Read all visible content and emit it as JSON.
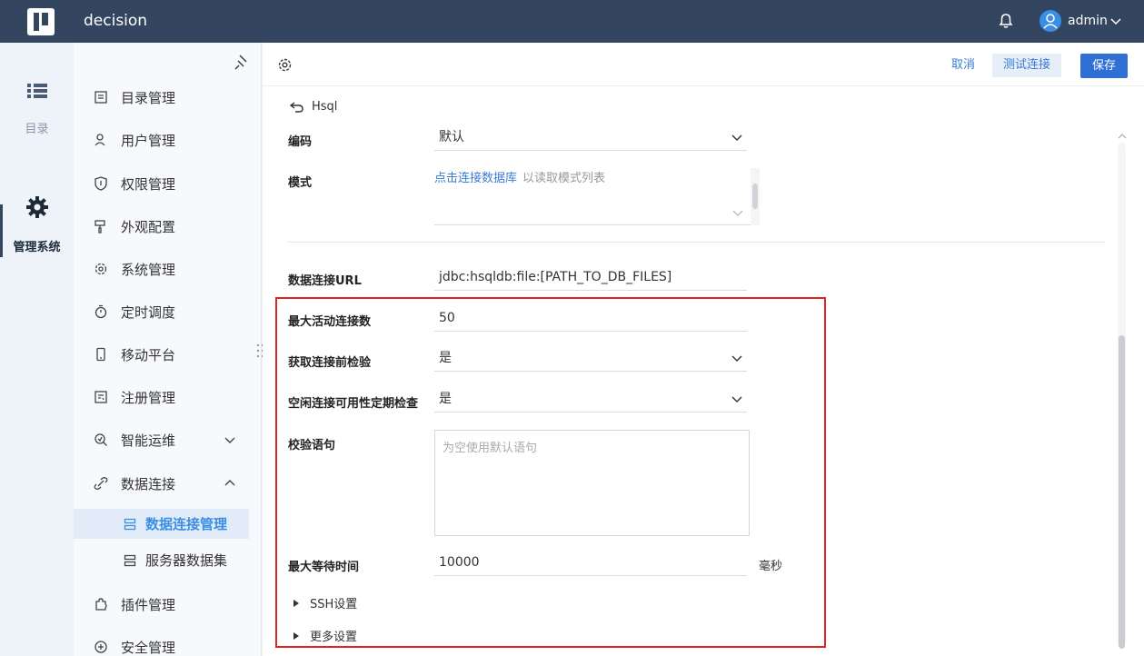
{
  "header": {
    "app_title": "decision",
    "username": "admin"
  },
  "rail": {
    "directory_label": "目录",
    "system_label": "管理系统"
  },
  "menu": {
    "items": [
      {
        "label": "目录管理",
        "icon": "list-icon"
      },
      {
        "label": "用户管理",
        "icon": "user-icon"
      },
      {
        "label": "权限管理",
        "icon": "shield-icon"
      },
      {
        "label": "外观配置",
        "icon": "paint-icon"
      },
      {
        "label": "系统管理",
        "icon": "gear-icon"
      },
      {
        "label": "定时调度",
        "icon": "timer-icon"
      },
      {
        "label": "移动平台",
        "icon": "mobile-icon"
      },
      {
        "label": "注册管理",
        "icon": "register-icon"
      },
      {
        "label": "智能运维",
        "icon": "ops-icon"
      },
      {
        "label": "数据连接",
        "icon": "link-icon"
      },
      {
        "label": "插件管理",
        "icon": "plugin-icon"
      },
      {
        "label": "安全管理",
        "icon": "security-icon"
      }
    ],
    "sub_items": [
      {
        "label": "数据连接管理",
        "icon": "database-icon"
      },
      {
        "label": "服务器数据集",
        "icon": "dataset-icon"
      }
    ]
  },
  "toolbar": {
    "cancel_label": "取消",
    "test_label": "测试连接",
    "save_label": "保存"
  },
  "breadcrumb": {
    "back_label": "Hsql"
  },
  "form": {
    "encoding": {
      "label": "编码",
      "value": "默认"
    },
    "schema": {
      "label": "模式",
      "link": "点击连接数据库",
      "hint": "以读取模式列表"
    },
    "url": {
      "label": "数据连接URL",
      "value": "jdbc:hsqldb:file:[PATH_TO_DB_FILES]"
    },
    "max_active": {
      "label": "最大活动连接数",
      "value": "50"
    },
    "test_before": {
      "label": "获取连接前检验",
      "value": "是"
    },
    "idle_check": {
      "label": "空闲连接可用性定期检查",
      "value": "是"
    },
    "validation": {
      "label": "校验语句",
      "placeholder": "为空使用默认语句"
    },
    "max_wait": {
      "label": "最大等待时间",
      "value": "10000",
      "unit": "毫秒"
    },
    "ssh_label": "SSH设置",
    "more_label": "更多设置"
  },
  "colors": {
    "topbar": "#344560",
    "accent": "#3a8ee6",
    "primary_button": "#2f6fd6",
    "highlight_border": "#e02424"
  }
}
